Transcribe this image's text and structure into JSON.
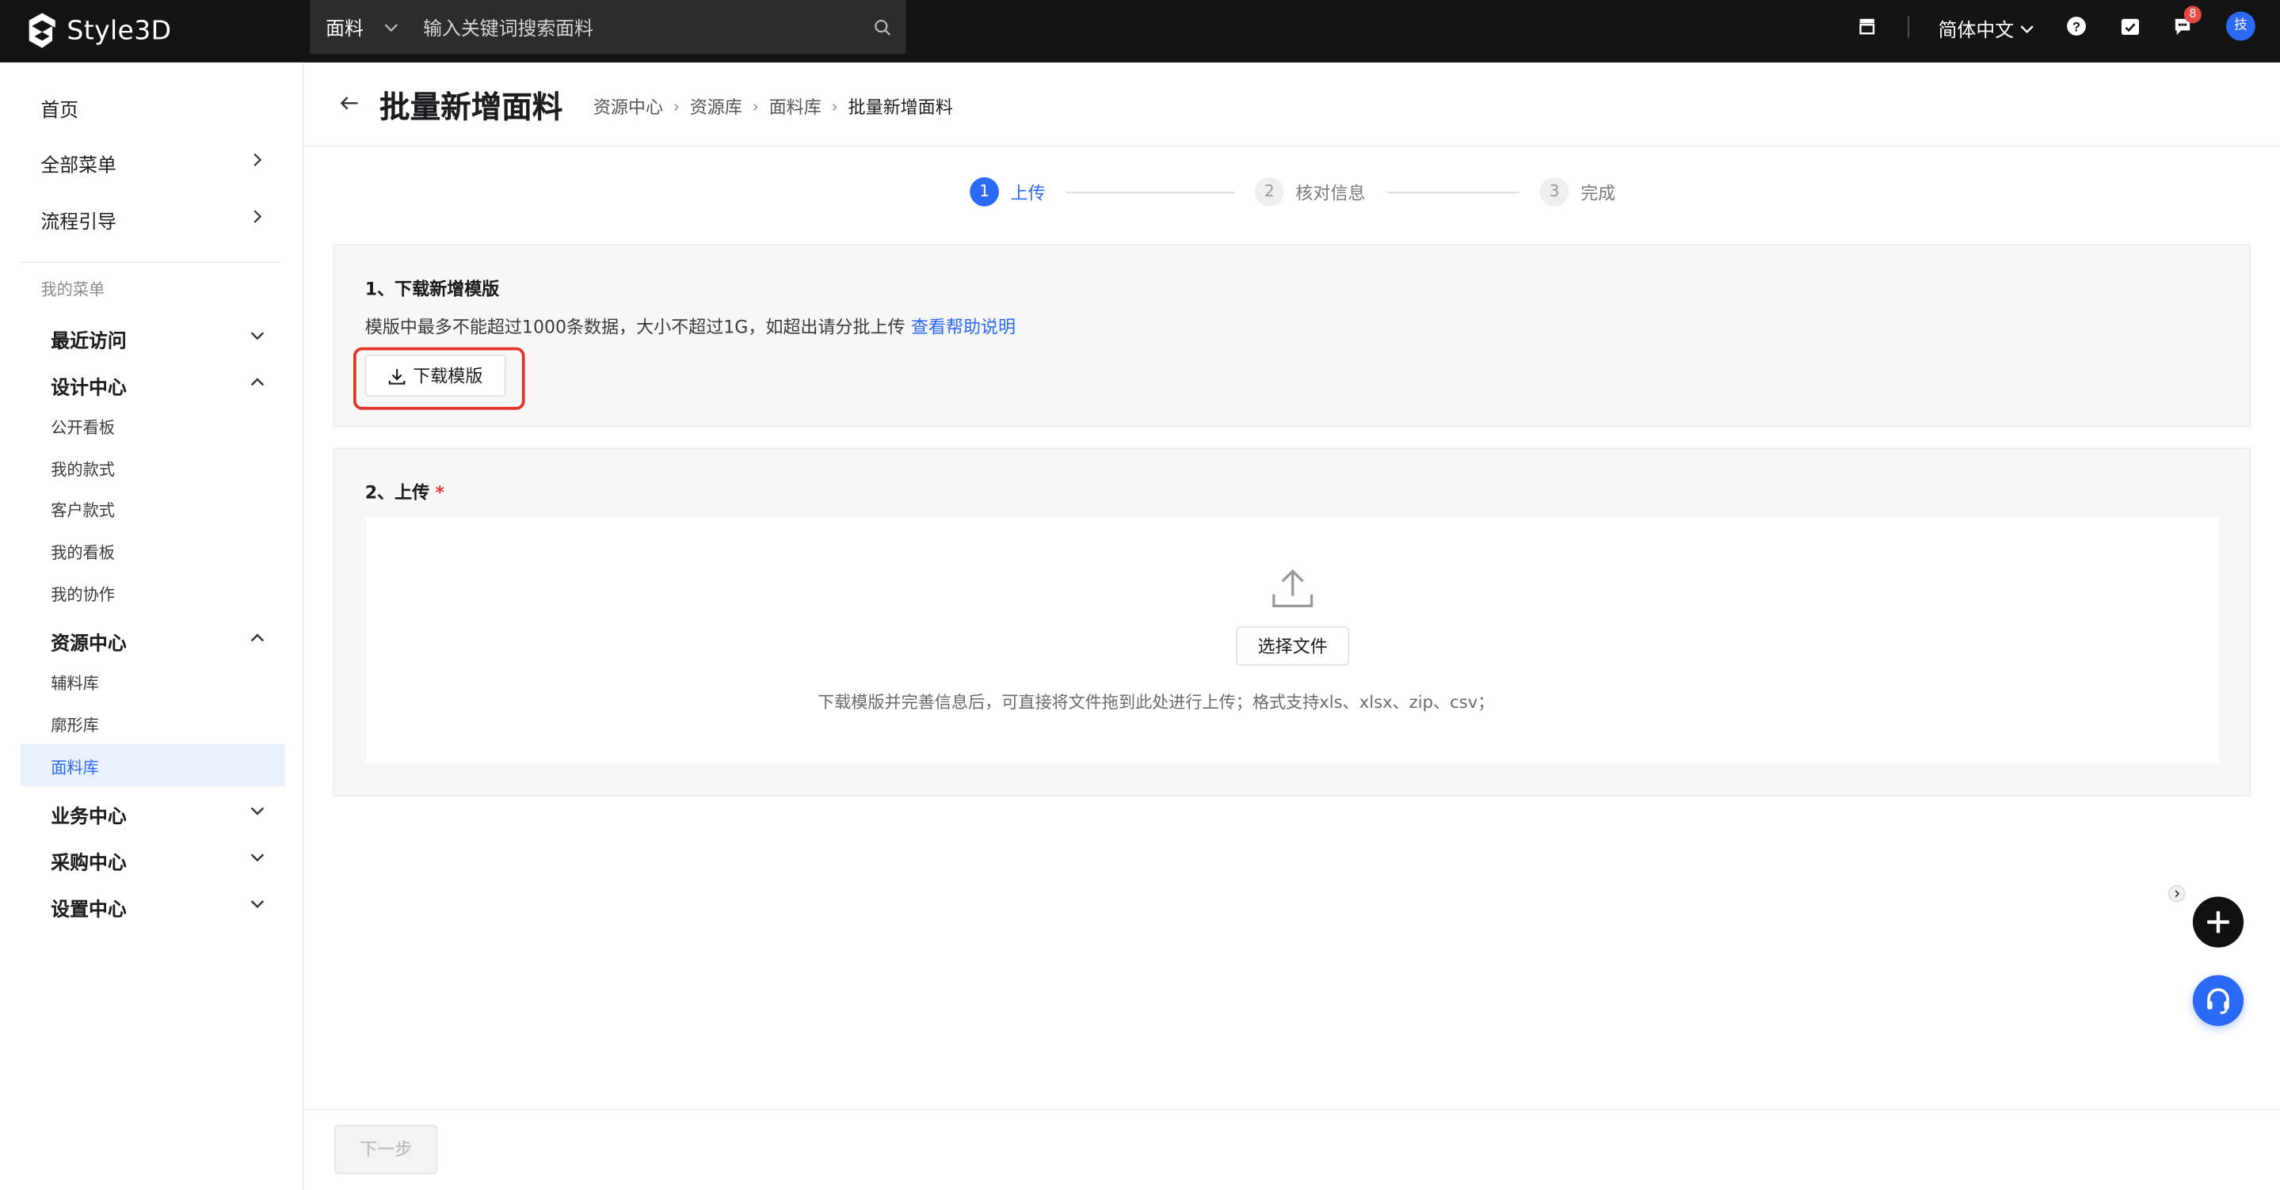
{
  "topbar": {
    "brand": "Style3D",
    "search": {
      "category": "面料",
      "placeholder": "输入关键词搜索面料"
    },
    "language": "简体中文",
    "message_count": "8",
    "avatar_initial": "技"
  },
  "sidebar": {
    "top_items": [
      {
        "label": "首页"
      },
      {
        "label": "全部菜单"
      },
      {
        "label": "流程引导"
      }
    ],
    "my_menu_label": "我的菜单",
    "groups": {
      "recent": "最近访问",
      "design": "设计中心",
      "design_items": [
        "公开看板",
        "我的款式",
        "客户款式",
        "我的看板",
        "我的协作"
      ],
      "resource": "资源中心",
      "resource_items": [
        "辅料库",
        "廓形库",
        "面料库"
      ],
      "business": "业务中心",
      "purchase": "采购中心",
      "settings": "设置中心"
    }
  },
  "header": {
    "title": "批量新增面料",
    "breadcrumb": [
      "资源中心",
      "资源库",
      "面料库",
      "批量新增面料"
    ]
  },
  "steps": [
    {
      "num": "1",
      "label": "上传",
      "state": "active"
    },
    {
      "num": "2",
      "label": "核对信息",
      "state": "pending"
    },
    {
      "num": "3",
      "label": "完成",
      "state": "pending"
    }
  ],
  "section1": {
    "title": "1、下载新增模版",
    "hint": "模版中最多不能超过1000条数据，大小不超过1G，如超出请分批上传",
    "help_link": "查看帮助说明",
    "download_button": "下载模版"
  },
  "section2": {
    "title": "2、上传",
    "required_mark": "*",
    "select_button": "选择文件",
    "drop_hint": "下载模版并完善信息后，可直接将文件拖到此处进行上传；格式支持xls、xlsx、zip、csv；"
  },
  "footer": {
    "next_button": "下一步"
  },
  "colors": {
    "primary": "#2a6af6",
    "topbar": "#141414",
    "highlight": "#e3342a"
  }
}
